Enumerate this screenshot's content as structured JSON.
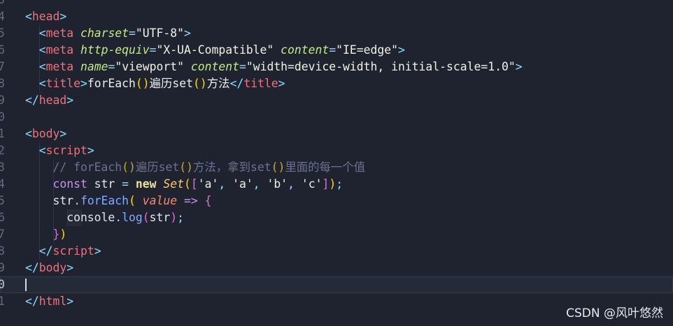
{
  "editor": {
    "line_numbers": [
      "3",
      "4",
      "5",
      "6",
      "7",
      "8",
      "9",
      "0",
      "1",
      "2",
      "3",
      "4",
      "5",
      "6",
      "7",
      "8",
      "9",
      "0",
      "1"
    ],
    "lines": [
      {
        "tokens": []
      },
      {
        "tokens": [
          {
            "c": "pn",
            "t": "<"
          },
          {
            "c": "tg",
            "t": "head"
          },
          {
            "c": "pn",
            "t": ">"
          }
        ]
      },
      {
        "tokens": [
          {
            "c": "pn",
            "t": "  <"
          },
          {
            "c": "tg",
            "t": "meta"
          },
          {
            "c": "tx",
            "t": " "
          },
          {
            "c": "at",
            "t": "charset"
          },
          {
            "c": "pn",
            "t": "="
          },
          {
            "c": "av",
            "t": "\"UTF-8\""
          },
          {
            "c": "pn",
            "t": ">"
          }
        ]
      },
      {
        "tokens": [
          {
            "c": "pn",
            "t": "  <"
          },
          {
            "c": "tg",
            "t": "meta"
          },
          {
            "c": "tx",
            "t": " "
          },
          {
            "c": "at",
            "t": "http-equiv"
          },
          {
            "c": "pn",
            "t": "="
          },
          {
            "c": "av",
            "t": "\"X-UA-Compatible\""
          },
          {
            "c": "tx",
            "t": " "
          },
          {
            "c": "at",
            "t": "content"
          },
          {
            "c": "pn",
            "t": "="
          },
          {
            "c": "av",
            "t": "\"IE=edge\""
          },
          {
            "c": "pn",
            "t": ">"
          }
        ]
      },
      {
        "tokens": [
          {
            "c": "pn",
            "t": "  <"
          },
          {
            "c": "tg",
            "t": "meta"
          },
          {
            "c": "tx",
            "t": " "
          },
          {
            "c": "at",
            "t": "name"
          },
          {
            "c": "pn",
            "t": "="
          },
          {
            "c": "av",
            "t": "\"viewport\""
          },
          {
            "c": "tx",
            "t": " "
          },
          {
            "c": "at",
            "t": "content"
          },
          {
            "c": "pn",
            "t": "="
          },
          {
            "c": "av",
            "t": "\"width=device-width, initial-scale=1.0\""
          },
          {
            "c": "pn",
            "t": ">"
          }
        ]
      },
      {
        "tokens": [
          {
            "c": "pn",
            "t": "  <"
          },
          {
            "c": "tg",
            "t": "title"
          },
          {
            "c": "pn",
            "t": ">"
          },
          {
            "c": "tx",
            "t": "forEach"
          },
          {
            "c": "br",
            "t": "()"
          },
          {
            "c": "tx",
            "t": "遍历set"
          },
          {
            "c": "br",
            "t": "()"
          },
          {
            "c": "tx",
            "t": "方法"
          },
          {
            "c": "pn",
            "t": "</"
          },
          {
            "c": "tg",
            "t": "title"
          },
          {
            "c": "pn",
            "t": ">"
          }
        ]
      },
      {
        "tokens": [
          {
            "c": "pn",
            "t": "</"
          },
          {
            "c": "tg",
            "t": "head"
          },
          {
            "c": "pn",
            "t": ">"
          }
        ]
      },
      {
        "tokens": []
      },
      {
        "tokens": [
          {
            "c": "pn",
            "t": "<"
          },
          {
            "c": "tg",
            "t": "body"
          },
          {
            "c": "pn",
            "t": ">"
          }
        ]
      },
      {
        "tokens": [
          {
            "c": "pn",
            "t": "  <"
          },
          {
            "c": "tg",
            "t": "script"
          },
          {
            "c": "pn",
            "t": ">"
          }
        ]
      },
      {
        "tokens": [
          {
            "c": "cm",
            "t": "    // forEach"
          },
          {
            "c": "cmb",
            "t": "()"
          },
          {
            "c": "cm",
            "t": "遍历set"
          },
          {
            "c": "cmb",
            "t": "()"
          },
          {
            "c": "cm",
            "t": "方法，拿到set"
          },
          {
            "c": "cmb",
            "t": "()"
          },
          {
            "c": "cm",
            "t": "里面的每一个值"
          }
        ]
      },
      {
        "tokens": [
          {
            "c": "kw",
            "t": "    const"
          },
          {
            "c": "vr",
            "t": " str "
          },
          {
            "c": "pn",
            "t": "="
          },
          {
            "c": "tx",
            "t": " "
          },
          {
            "c": "nw",
            "t": "new"
          },
          {
            "c": "tx",
            "t": " "
          },
          {
            "c": "cl",
            "t": "Set"
          },
          {
            "c": "br",
            "t": "("
          },
          {
            "c": "br2",
            "t": "["
          },
          {
            "c": "st",
            "t": "'a'"
          },
          {
            "c": "pn",
            "t": ", "
          },
          {
            "c": "st",
            "t": "'a'"
          },
          {
            "c": "pn",
            "t": ", "
          },
          {
            "c": "st",
            "t": "'b'"
          },
          {
            "c": "pn",
            "t": ", "
          },
          {
            "c": "st",
            "t": "'c'"
          },
          {
            "c": "br2",
            "t": "]"
          },
          {
            "c": "br",
            "t": ")"
          },
          {
            "c": "pn",
            "t": ";"
          }
        ]
      },
      {
        "tokens": [
          {
            "c": "vr",
            "t": "    str"
          },
          {
            "c": "pn",
            "t": "."
          },
          {
            "c": "fn",
            "t": "forEach"
          },
          {
            "c": "br",
            "t": "("
          },
          {
            "c": "tx",
            "t": " "
          },
          {
            "c": "pm",
            "t": "value"
          },
          {
            "c": "tx",
            "t": " "
          },
          {
            "c": "kw",
            "t": "=>"
          },
          {
            "c": "tx",
            "t": " "
          },
          {
            "c": "br2",
            "t": "{"
          }
        ]
      },
      {
        "tokens": [
          {
            "c": "vr",
            "t": "      console"
          },
          {
            "c": "pn",
            "t": "."
          },
          {
            "c": "fn",
            "t": "log"
          },
          {
            "c": "br2",
            "t": "("
          },
          {
            "c": "vr",
            "t": "str"
          },
          {
            "c": "br2",
            "t": ")"
          },
          {
            "c": "pn",
            "t": ";"
          }
        ]
      },
      {
        "tokens": [
          {
            "c": "br2",
            "t": "    }"
          },
          {
            "c": "br",
            "t": ")"
          }
        ]
      },
      {
        "tokens": [
          {
            "c": "pn",
            "t": "  </"
          },
          {
            "c": "tg",
            "t": "script"
          },
          {
            "c": "pn",
            "t": ">"
          }
        ]
      },
      {
        "tokens": [
          {
            "c": "pn",
            "t": "</"
          },
          {
            "c": "tg",
            "t": "body"
          },
          {
            "c": "pn",
            "t": ">"
          }
        ]
      },
      {
        "tokens": []
      },
      {
        "tokens": [
          {
            "c": "pn",
            "t": "</"
          },
          {
            "c": "tg",
            "t": "html"
          },
          {
            "c": "pn",
            "t": ">"
          }
        ]
      }
    ],
    "current_line_index": 17
  },
  "watermark": "CSDN @风叶悠然",
  "colors": {
    "background": "#1f2330",
    "tag": "#f07178",
    "attribute": "#c3e88d",
    "keyword": "#c792ea",
    "function": "#82aaff",
    "class": "#ffcb6b",
    "comment": "#6a7290"
  }
}
